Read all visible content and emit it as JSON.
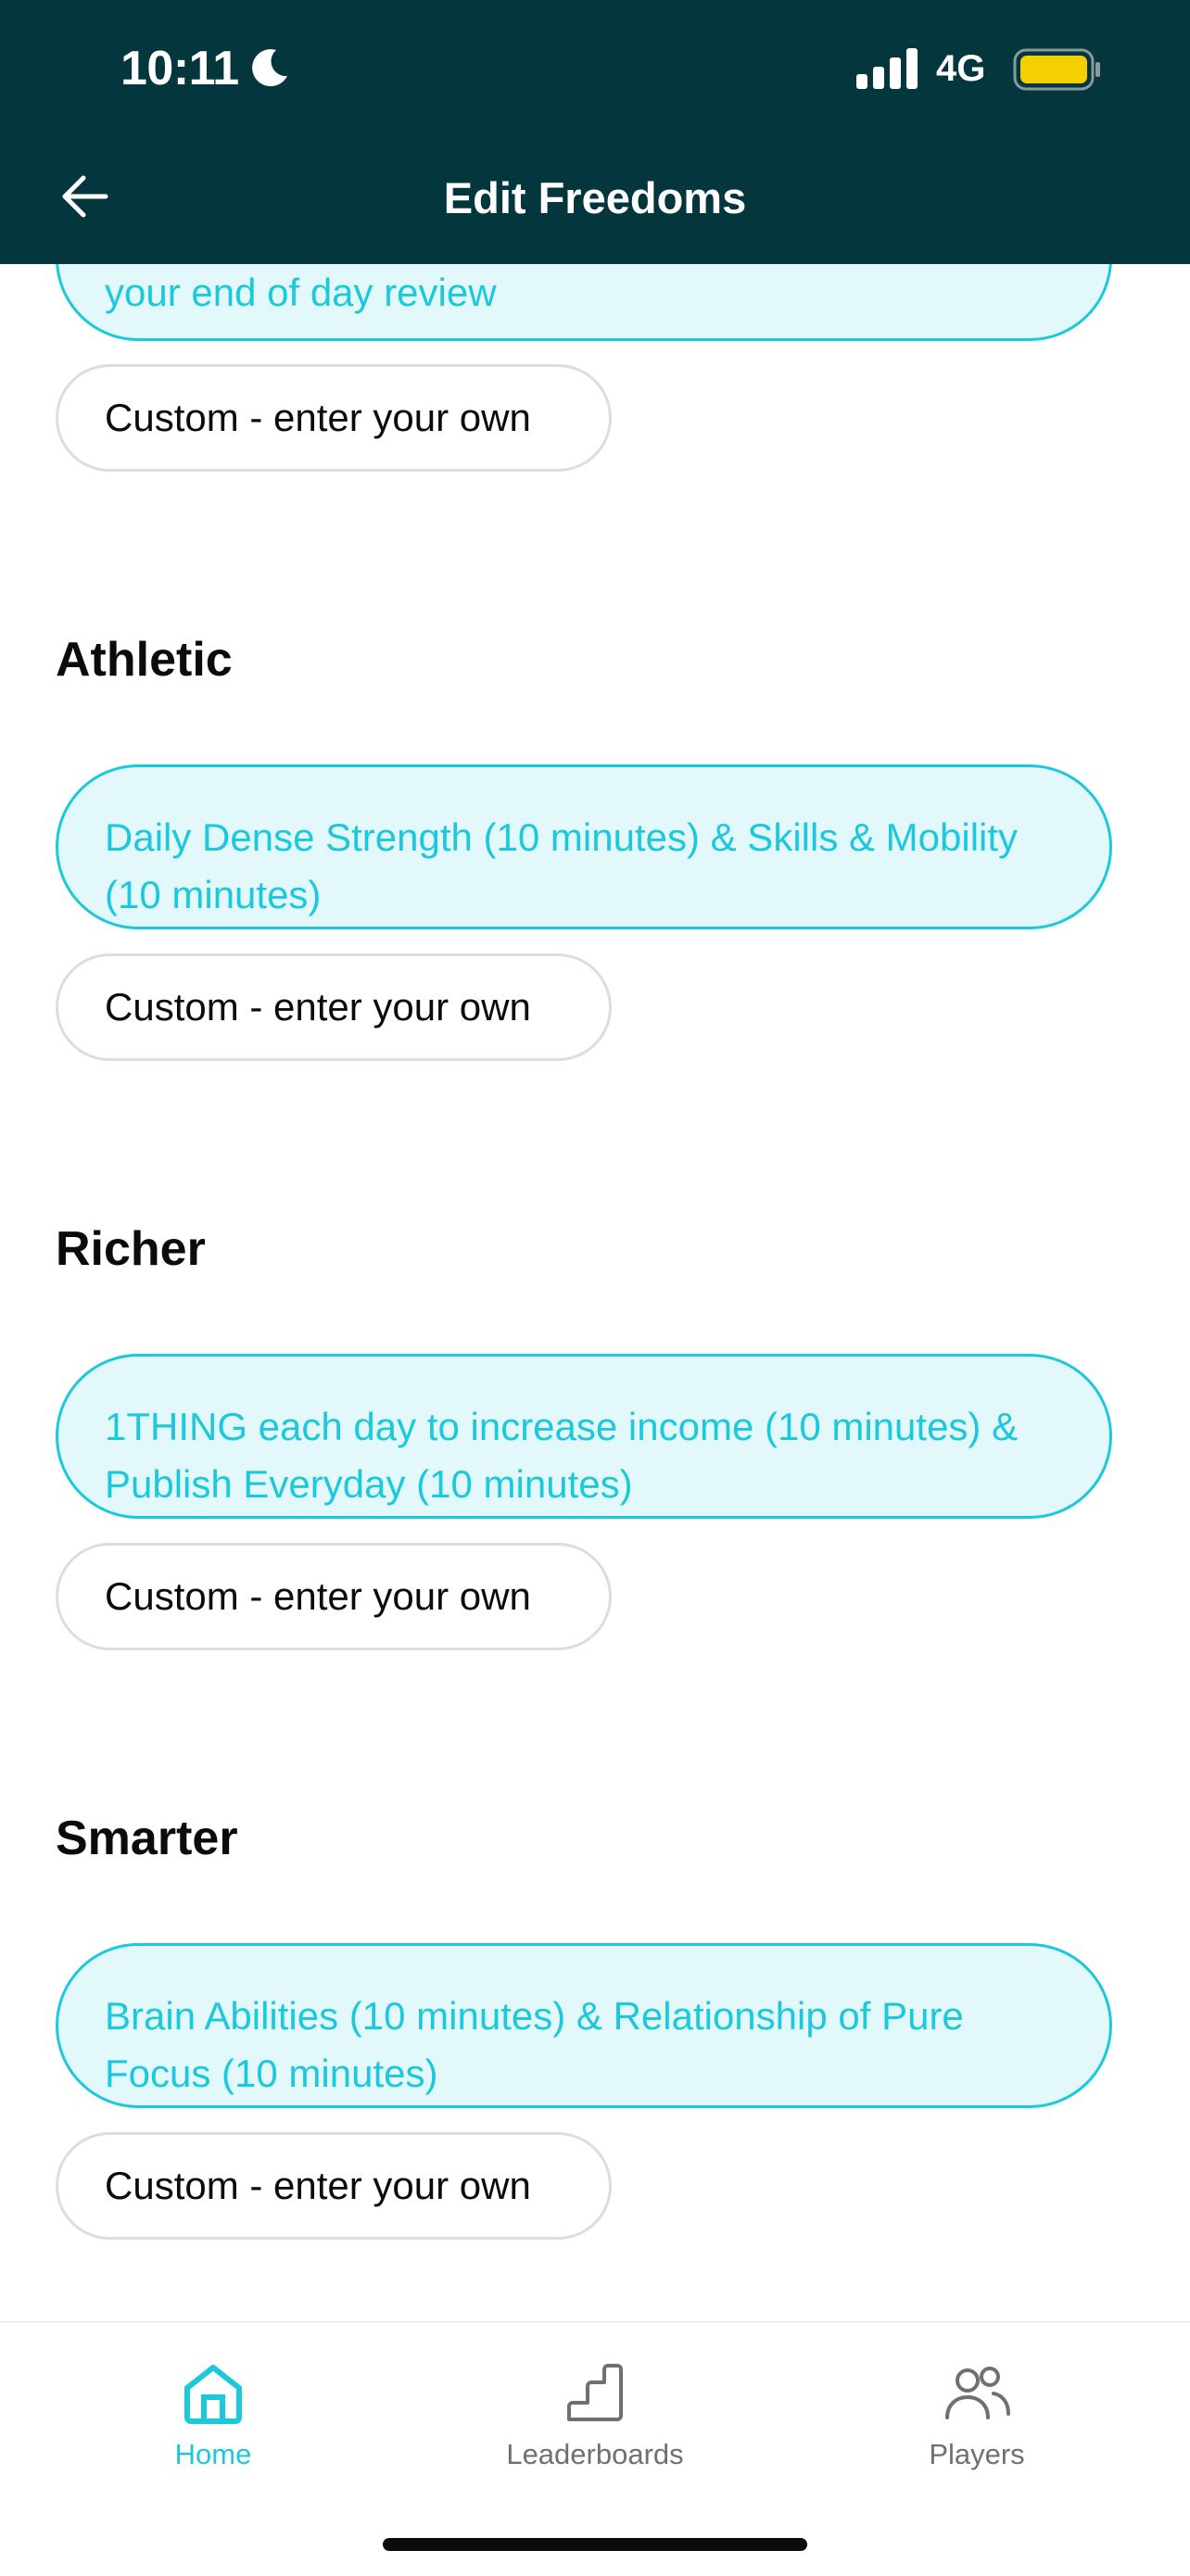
{
  "status_bar": {
    "time": "10:11",
    "network": "4G"
  },
  "header": {
    "title": "Edit Freedoms"
  },
  "sections": [
    {
      "title": "",
      "selected": "your end of day review",
      "custom": "Custom - enter your own"
    },
    {
      "title": "Athletic",
      "selected": "Daily Dense Strength (10 minutes) & Skills & Mobility (10 minutes)",
      "custom": "Custom - enter your own"
    },
    {
      "title": "Richer",
      "selected": "1THING each day to increase income (10 minutes) & Publish Everyday (10 minutes)",
      "custom": "Custom - enter your own"
    },
    {
      "title": "Smarter",
      "selected": "Brain Abilities (10 minutes) & Relationship of Pure Focus (10 minutes)",
      "custom": "Custom - enter your own"
    }
  ],
  "tabs": [
    {
      "label": "Home",
      "icon": "home-icon",
      "active": true
    },
    {
      "label": "Leaderboards",
      "icon": "stairs-icon",
      "active": false
    },
    {
      "label": "Players",
      "icon": "people-icon",
      "active": false
    }
  ],
  "colors": {
    "header_bg": "#04363d",
    "accent": "#1cc8db",
    "selected_bg": "#e3f8fb",
    "battery": "#f5d000"
  }
}
